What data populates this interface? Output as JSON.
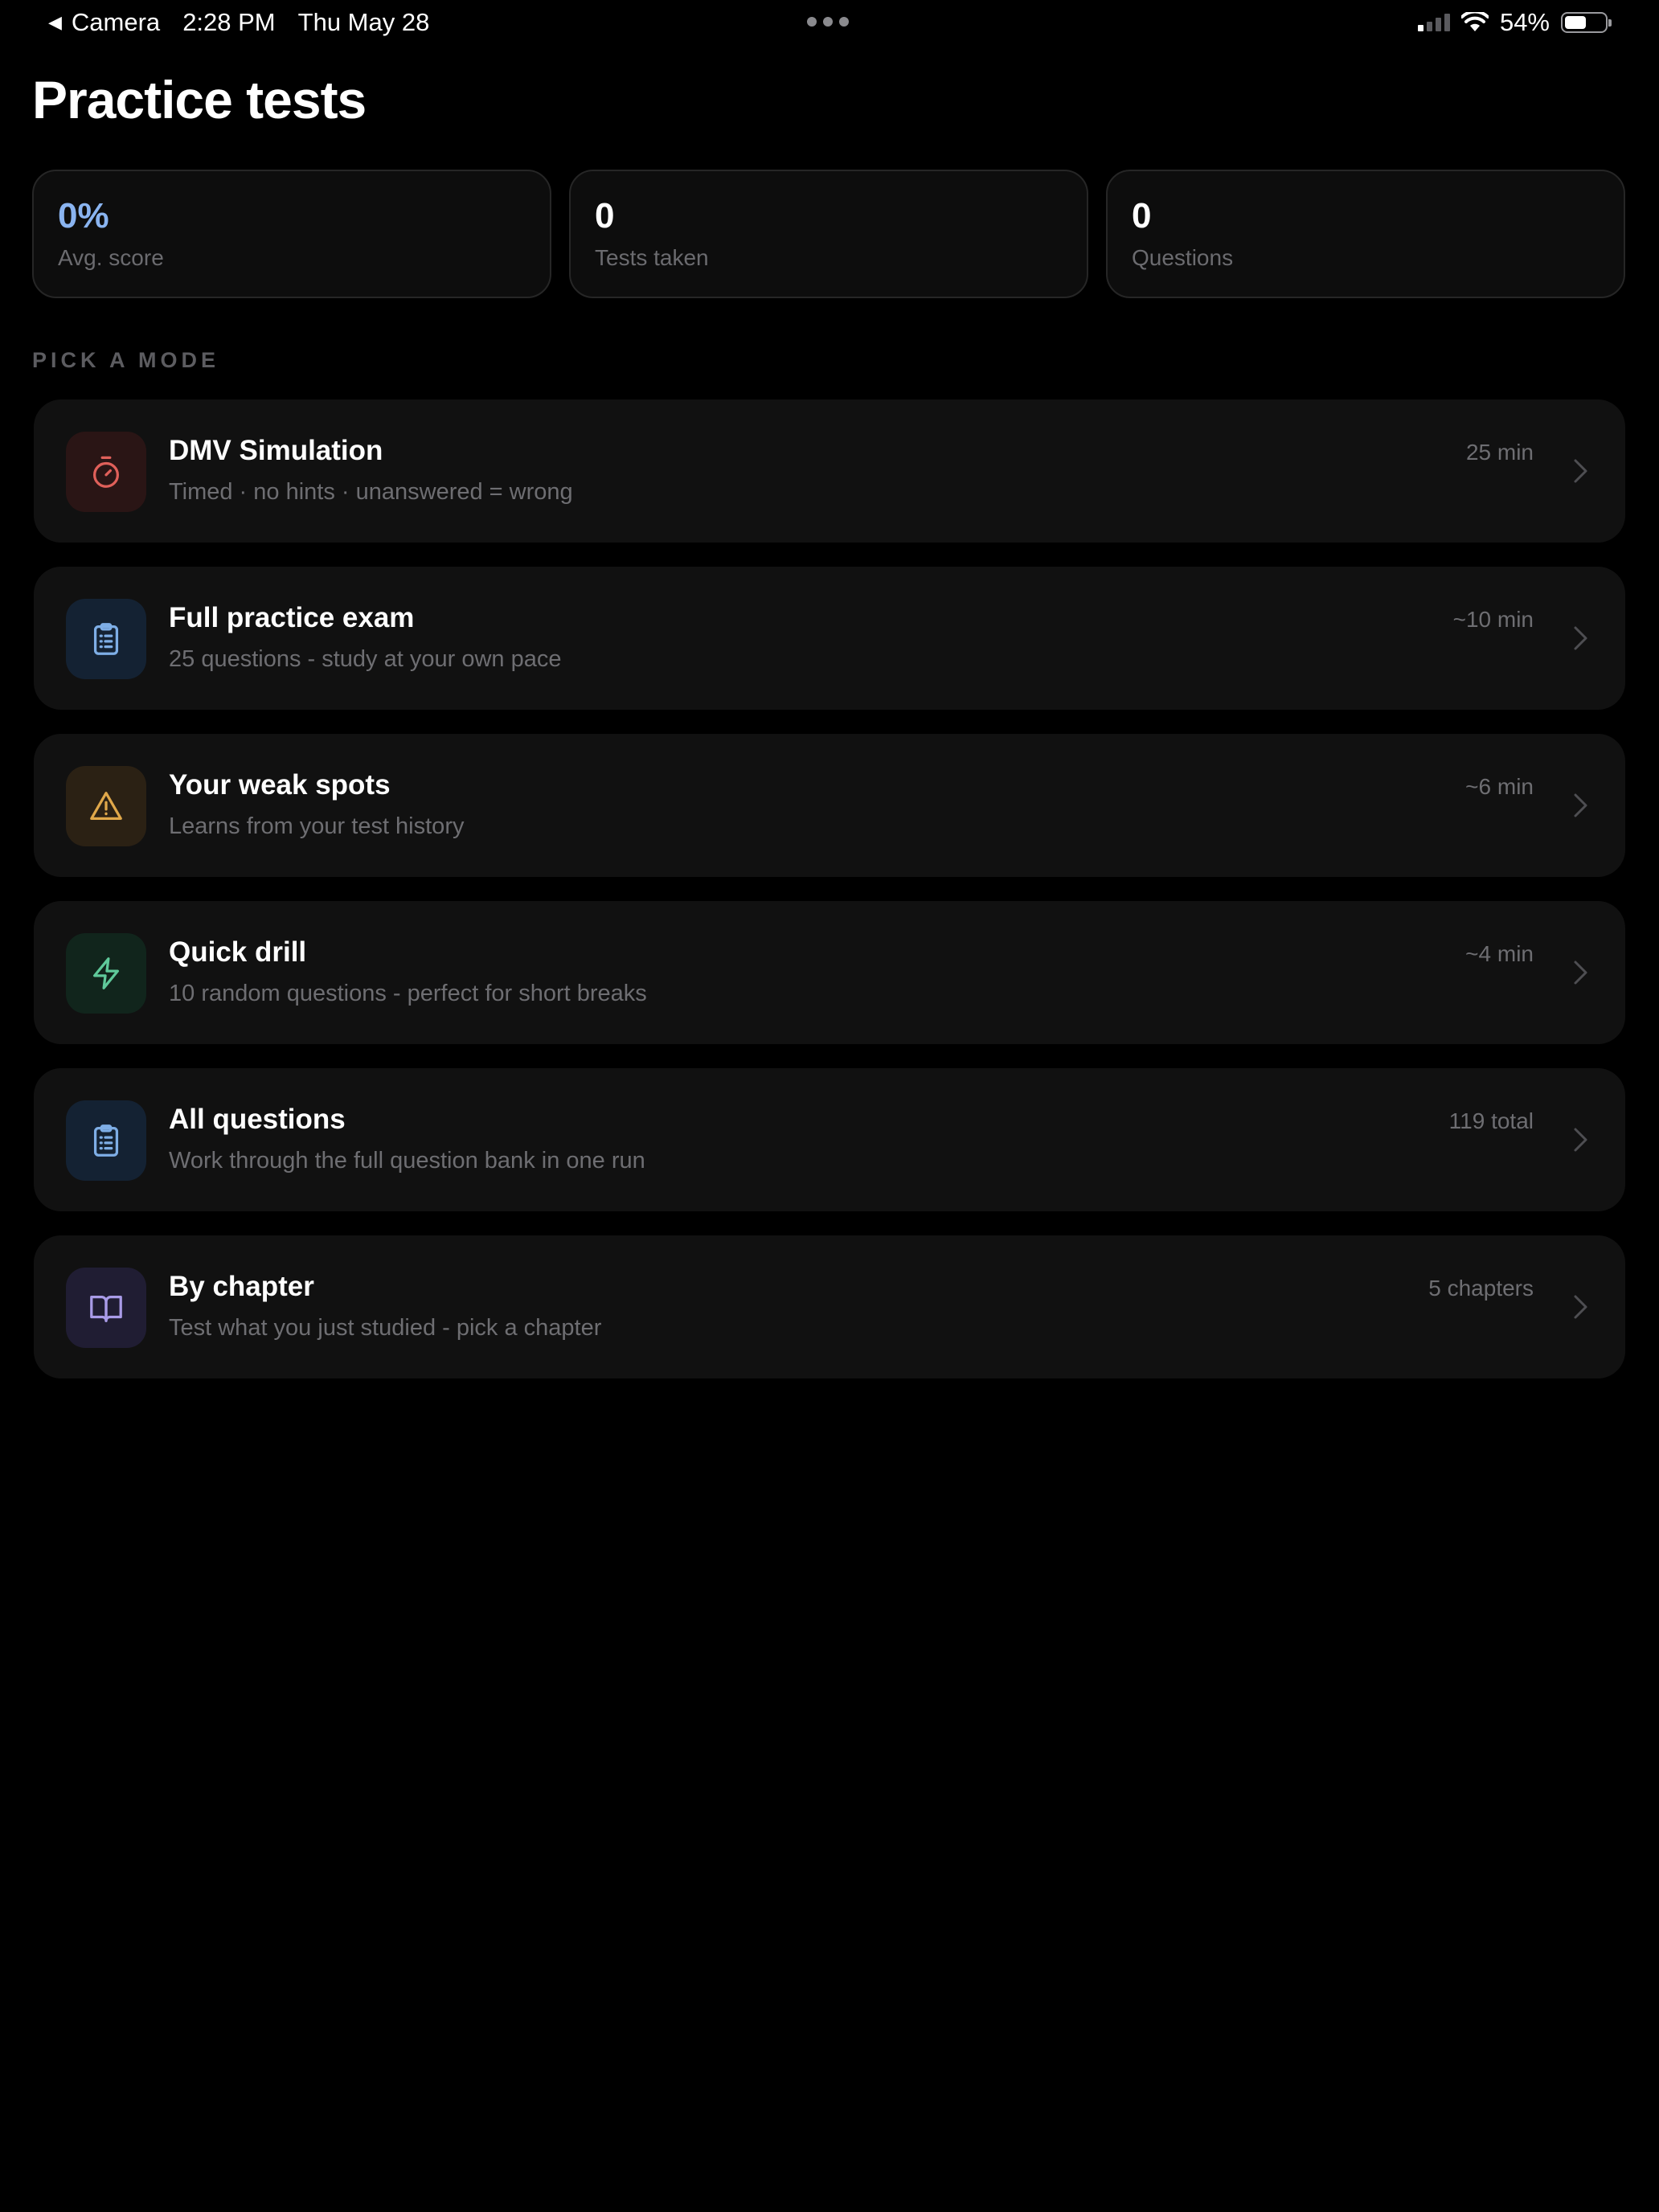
{
  "status_bar": {
    "back_app": "Camera",
    "time": "2:28 PM",
    "date": "Thu May 28",
    "battery": "54%",
    "battery_level": 0.54
  },
  "page": {
    "title": "Practice tests"
  },
  "stats": [
    {
      "value": "0%",
      "label": "Avg. score"
    },
    {
      "value": "0",
      "label": "Tests taken"
    },
    {
      "value": "0",
      "label": "Questions"
    }
  ],
  "section": {
    "heading": "PICK A MODE"
  },
  "modes": [
    {
      "title": "DMV Simulation",
      "subtitle": "Timed · no hints · unanswered = wrong",
      "meta": "25 min",
      "icon": "stopwatch-icon",
      "color": "#e0605a",
      "bg": "#2a1515"
    },
    {
      "title": "Full practice exam",
      "subtitle": "25 questions - study at your own pace",
      "meta": "~10 min",
      "icon": "clipboard-list-icon",
      "color": "#7eaee6",
      "bg": "#142233"
    },
    {
      "title": "Your weak spots",
      "subtitle": "Learns from your test history",
      "meta": "~6 min",
      "icon": "warning-triangle-icon",
      "color": "#e0a84a",
      "bg": "#2b2114"
    },
    {
      "title": "Quick drill",
      "subtitle": "10 random questions - perfect for short breaks",
      "meta": "~4 min",
      "icon": "lightning-icon",
      "color": "#5fc99a",
      "bg": "#11251c"
    },
    {
      "title": "All questions",
      "subtitle": "Work through the full question bank in one run",
      "meta": "119 total",
      "icon": "clipboard-list-icon",
      "color": "#7eaee6",
      "bg": "#142233"
    },
    {
      "title": "By chapter",
      "subtitle": "Test what you just studied - pick a chapter",
      "meta": "5 chapters",
      "icon": "open-book-icon",
      "color": "#a99be8",
      "bg": "#201d33"
    }
  ]
}
